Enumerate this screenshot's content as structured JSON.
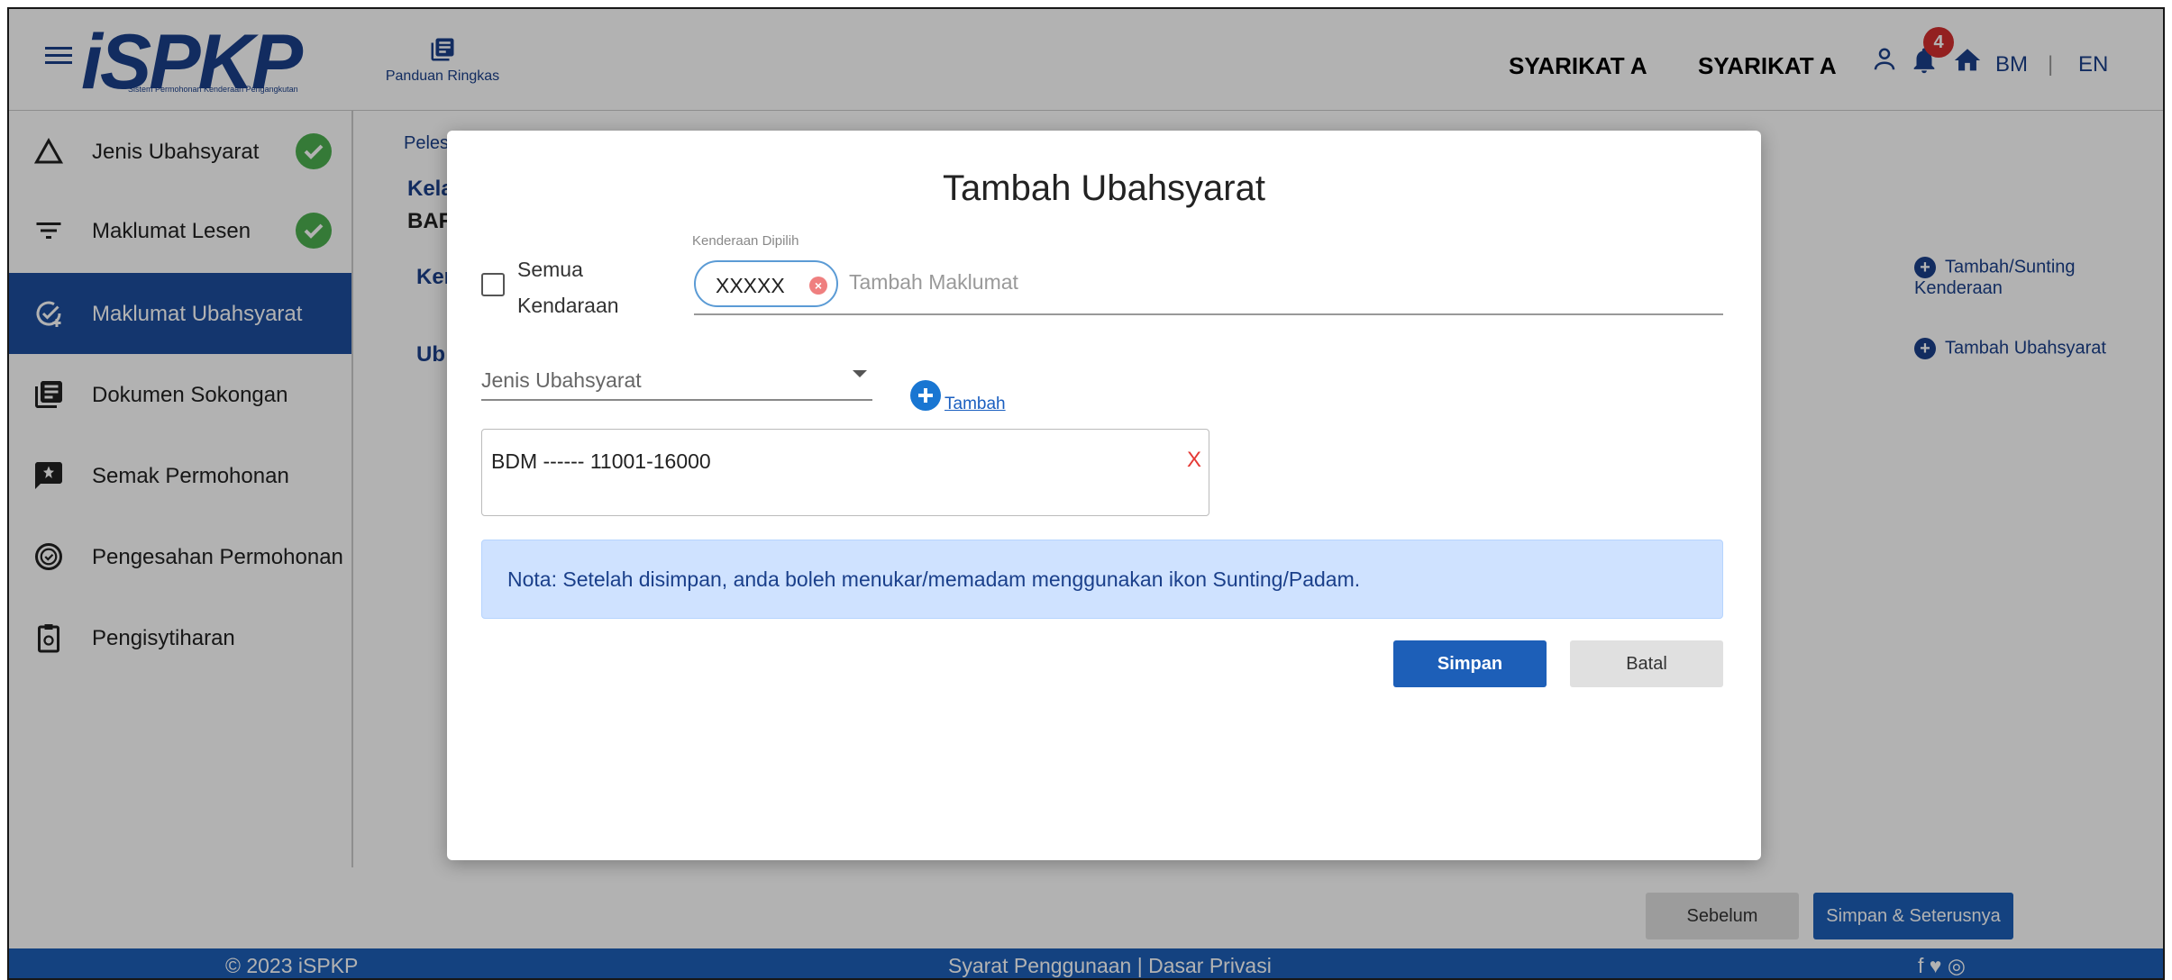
{
  "header": {
    "logo_text": "iSPKP",
    "logo_subtitle": "Sistem Permohonan Kenderaan Pengangkutan",
    "guide_label": "Panduan Ringkas",
    "company_1": "SYARIKAT A",
    "company_2": "SYARIKAT A",
    "notification_count": "4",
    "lang_bm": "BM",
    "lang_sep": "|",
    "lang_en": "EN"
  },
  "sidebar": {
    "items": [
      {
        "label": "Jenis Ubahsyarat",
        "icon": "triangle-icon",
        "completed": true
      },
      {
        "label": "Maklumat Lesen",
        "icon": "filter-icon",
        "completed": true
      },
      {
        "label": "Maklumat Ubahsyarat",
        "icon": "task-add-icon",
        "completed": false,
        "active": true
      },
      {
        "label": "Dokumen Sokongan",
        "icon": "documents-icon",
        "completed": false
      },
      {
        "label": "Semak Permohonan",
        "icon": "feedback-icon",
        "completed": false
      },
      {
        "label": "Pengesahan Permohonan",
        "icon": "verified-icon",
        "completed": false
      },
      {
        "label": "Pengisytiharan",
        "icon": "clipboard-icon",
        "completed": false
      }
    ]
  },
  "main": {
    "partial_pele": "Peles",
    "partial_kela": "Kela",
    "partial_bar": "BAR",
    "partial_ker": "Ker",
    "partial_ub": "Ub",
    "link_vehicle": "Tambah/Sunting Kenderaan",
    "link_ubahsyarat": "Tambah Ubahsyarat"
  },
  "footer": {
    "prev_button": "Sebelum",
    "next_button": "Simpan & Seterusnya",
    "copyright": "© 2023 iSPKP",
    "links": "Syarat Penggunaan | Dasar Privasi",
    "social": "f  ♥  ◎"
  },
  "modal": {
    "title": "Tambah Ubahsyarat",
    "all_vehicles_label": "Semua Kendaraan",
    "all_vehicles_checked": false,
    "selected_vehicles_label": "Kenderaan Dipilih",
    "chip_value": "XXXXX",
    "add_info_placeholder": "Tambah Maklumat",
    "type_select_value": "Jenis Ubahsyarat",
    "add_button_label": "Tambah",
    "list_items": [
      "BDM ------ 11001-16000"
    ],
    "remove_label": "X",
    "note": "Nota: Setelah disimpan, anda boleh menukar/memadam menggunakan ikon Sunting/Padam.",
    "save_button": "Simpan",
    "cancel_button": "Batal"
  },
  "colors": {
    "primary": "#1d5fb8",
    "sidebar_active": "#1d4e9e",
    "success": "#4caf50",
    "danger": "#e53935",
    "note_bg": "#cfe2ff"
  }
}
